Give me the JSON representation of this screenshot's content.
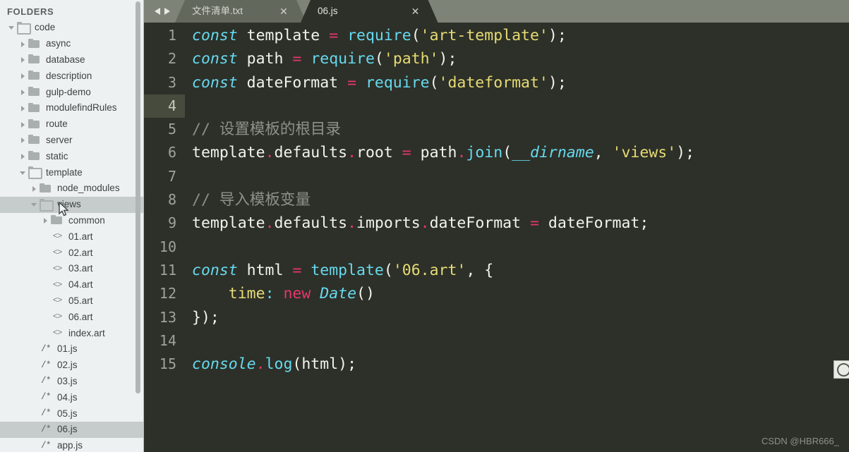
{
  "sidebar": {
    "header": "FOLDERS",
    "scrollbar": {
      "name": "sidebar-scrollbar"
    },
    "tree": [
      {
        "label": "code",
        "depth": 0,
        "kind": "folder",
        "state": "open",
        "selected": false
      },
      {
        "label": "async",
        "depth": 1,
        "kind": "folder",
        "state": "closed",
        "selected": false
      },
      {
        "label": "database",
        "depth": 1,
        "kind": "folder",
        "state": "closed",
        "selected": false
      },
      {
        "label": "description",
        "depth": 1,
        "kind": "folder",
        "state": "closed",
        "selected": false
      },
      {
        "label": "gulp-demo",
        "depth": 1,
        "kind": "folder",
        "state": "closed",
        "selected": false
      },
      {
        "label": "modulefindRules",
        "depth": 1,
        "kind": "folder",
        "state": "closed",
        "selected": false
      },
      {
        "label": "route",
        "depth": 1,
        "kind": "folder",
        "state": "closed",
        "selected": false
      },
      {
        "label": "server",
        "depth": 1,
        "kind": "folder",
        "state": "closed",
        "selected": false
      },
      {
        "label": "static",
        "depth": 1,
        "kind": "folder",
        "state": "closed",
        "selected": false
      },
      {
        "label": "template",
        "depth": 1,
        "kind": "folder",
        "state": "open",
        "selected": false
      },
      {
        "label": "node_modules",
        "depth": 2,
        "kind": "folder",
        "state": "closed",
        "selected": false
      },
      {
        "label": "views",
        "depth": 2,
        "kind": "folder",
        "state": "open",
        "selected": true
      },
      {
        "label": "common",
        "depth": 3,
        "kind": "folder",
        "state": "closed",
        "selected": false
      },
      {
        "label": "01.art",
        "depth": 3,
        "kind": "art",
        "state": "file",
        "selected": false
      },
      {
        "label": "02.art",
        "depth": 3,
        "kind": "art",
        "state": "file",
        "selected": false
      },
      {
        "label": "03.art",
        "depth": 3,
        "kind": "art",
        "state": "file",
        "selected": false
      },
      {
        "label": "04.art",
        "depth": 3,
        "kind": "art",
        "state": "file",
        "selected": false
      },
      {
        "label": "05.art",
        "depth": 3,
        "kind": "art",
        "state": "file",
        "selected": false
      },
      {
        "label": "06.art",
        "depth": 3,
        "kind": "art",
        "state": "file",
        "selected": false
      },
      {
        "label": "index.art",
        "depth": 3,
        "kind": "art",
        "state": "file",
        "selected": false
      },
      {
        "label": "01.js",
        "depth": 2,
        "kind": "js",
        "state": "file",
        "selected": false
      },
      {
        "label": "02.js",
        "depth": 2,
        "kind": "js",
        "state": "file",
        "selected": false
      },
      {
        "label": "03.js",
        "depth": 2,
        "kind": "js",
        "state": "file",
        "selected": false
      },
      {
        "label": "04.js",
        "depth": 2,
        "kind": "js",
        "state": "file",
        "selected": false
      },
      {
        "label": "05.js",
        "depth": 2,
        "kind": "js",
        "state": "file",
        "selected": false
      },
      {
        "label": "06.js",
        "depth": 2,
        "kind": "js",
        "state": "file",
        "selected": true
      },
      {
        "label": "app.js",
        "depth": 2,
        "kind": "js",
        "state": "file",
        "selected": false
      }
    ],
    "icons": {
      "art": "<>",
      "js": "/*"
    }
  },
  "tabbar": {
    "nav_prev": "prev-tab-arrow",
    "nav_next": "next-tab-arrow",
    "close_glyph": "✕",
    "tabs": [
      {
        "label": "文件清单.txt",
        "active": false
      },
      {
        "label": "06.js",
        "active": true
      }
    ]
  },
  "editor": {
    "active_line": 4,
    "lines": [
      {
        "n": "1",
        "tokens": [
          {
            "t": "const ",
            "c": "t-kw"
          },
          {
            "t": "template ",
            "c": "t-plain"
          },
          {
            "t": "=",
            "c": "t-op"
          },
          {
            "t": " ",
            "c": "t-plain"
          },
          {
            "t": "require",
            "c": "t-fn"
          },
          {
            "t": "(",
            "c": "t-punct"
          },
          {
            "t": "'art-template'",
            "c": "t-str"
          },
          {
            "t": ")",
            "c": "t-punct"
          },
          {
            "t": ";",
            "c": "t-punct"
          }
        ]
      },
      {
        "n": "2",
        "tokens": [
          {
            "t": "const ",
            "c": "t-kw"
          },
          {
            "t": "path ",
            "c": "t-plain"
          },
          {
            "t": "=",
            "c": "t-op"
          },
          {
            "t": " ",
            "c": "t-plain"
          },
          {
            "t": "require",
            "c": "t-fn"
          },
          {
            "t": "(",
            "c": "t-punct"
          },
          {
            "t": "'path'",
            "c": "t-str"
          },
          {
            "t": ")",
            "c": "t-punct"
          },
          {
            "t": ";",
            "c": "t-punct"
          }
        ]
      },
      {
        "n": "3",
        "tokens": [
          {
            "t": "const ",
            "c": "t-kw"
          },
          {
            "t": "dateFormat ",
            "c": "t-plain"
          },
          {
            "t": "=",
            "c": "t-op"
          },
          {
            "t": " ",
            "c": "t-plain"
          },
          {
            "t": "require",
            "c": "t-fn"
          },
          {
            "t": "(",
            "c": "t-punct"
          },
          {
            "t": "'dateformat'",
            "c": "t-str"
          },
          {
            "t": ")",
            "c": "t-punct"
          },
          {
            "t": ";",
            "c": "t-punct"
          }
        ]
      },
      {
        "n": "4",
        "tokens": []
      },
      {
        "n": "5",
        "tokens": [
          {
            "t": "// 设置模板的根目录",
            "c": "t-comment"
          }
        ]
      },
      {
        "n": "6",
        "tokens": [
          {
            "t": "template",
            "c": "t-plain"
          },
          {
            "t": ".",
            "c": "t-dot"
          },
          {
            "t": "defaults",
            "c": "t-plain"
          },
          {
            "t": ".",
            "c": "t-dot"
          },
          {
            "t": "root ",
            "c": "t-plain"
          },
          {
            "t": "=",
            "c": "t-op"
          },
          {
            "t": " ",
            "c": "t-plain"
          },
          {
            "t": "path",
            "c": "t-plain"
          },
          {
            "t": ".",
            "c": "t-dot"
          },
          {
            "t": "join",
            "c": "t-fn"
          },
          {
            "t": "(",
            "c": "t-punct"
          },
          {
            "t": "__dirname",
            "c": "t-ital"
          },
          {
            "t": ", ",
            "c": "t-punct"
          },
          {
            "t": "'views'",
            "c": "t-str"
          },
          {
            "t": ")",
            "c": "t-punct"
          },
          {
            "t": ";",
            "c": "t-punct"
          }
        ]
      },
      {
        "n": "7",
        "tokens": []
      },
      {
        "n": "8",
        "tokens": [
          {
            "t": "// 导入模板变量",
            "c": "t-comment"
          }
        ]
      },
      {
        "n": "9",
        "tokens": [
          {
            "t": "template",
            "c": "t-plain"
          },
          {
            "t": ".",
            "c": "t-dot"
          },
          {
            "t": "defaults",
            "c": "t-plain"
          },
          {
            "t": ".",
            "c": "t-dot"
          },
          {
            "t": "imports",
            "c": "t-plain"
          },
          {
            "t": ".",
            "c": "t-dot"
          },
          {
            "t": "dateFormat ",
            "c": "t-plain"
          },
          {
            "t": "=",
            "c": "t-op"
          },
          {
            "t": " ",
            "c": "t-plain"
          },
          {
            "t": "dateFormat",
            "c": "t-plain"
          },
          {
            "t": ";",
            "c": "t-punct"
          }
        ]
      },
      {
        "n": "10",
        "tokens": []
      },
      {
        "n": "11",
        "tokens": [
          {
            "t": "const ",
            "c": "t-kw"
          },
          {
            "t": "html ",
            "c": "t-plain"
          },
          {
            "t": "=",
            "c": "t-op"
          },
          {
            "t": " ",
            "c": "t-plain"
          },
          {
            "t": "template",
            "c": "t-fn"
          },
          {
            "t": "(",
            "c": "t-punct"
          },
          {
            "t": "'06.art'",
            "c": "t-str"
          },
          {
            "t": ", ",
            "c": "t-punct"
          },
          {
            "t": "{",
            "c": "t-punct"
          }
        ]
      },
      {
        "n": "12",
        "tokens": [
          {
            "t": "    ",
            "c": "t-plain"
          },
          {
            "t": "time",
            "c": "t-prop"
          },
          {
            "t": ":",
            "c": "t-colon"
          },
          {
            "t": " ",
            "c": "t-plain"
          },
          {
            "t": "new ",
            "c": "t-new"
          },
          {
            "t": "Date",
            "c": "t-ital"
          },
          {
            "t": "()",
            "c": "t-punct"
          }
        ]
      },
      {
        "n": "13",
        "tokens": [
          {
            "t": "});",
            "c": "t-punct"
          }
        ]
      },
      {
        "n": "14",
        "tokens": []
      },
      {
        "n": "15",
        "tokens": [
          {
            "t": "console",
            "c": "t-ital"
          },
          {
            "t": ".",
            "c": "t-dot"
          },
          {
            "t": "log",
            "c": "t-fn"
          },
          {
            "t": "(",
            "c": "t-punct"
          },
          {
            "t": "html",
            "c": "t-plain"
          },
          {
            "t": ")",
            "c": "t-punct"
          },
          {
            "t": ";",
            "c": "t-punct"
          }
        ]
      }
    ]
  },
  "watermark": "CSDN @HBR666_",
  "colors": {
    "sidebar_bg": "#eef1f1",
    "sidebar_selected": "#c6cbcb",
    "editor_bg": "#2d3028",
    "tabbar_bg": "#7e8377",
    "tab_inactive_bg": "#63685d",
    "keyword": "#66d9ef",
    "string": "#e6db74",
    "operator": "#e6366f",
    "comment": "#8d9189",
    "plain": "#f2f3ed",
    "current_line_gutter": "#474b3e"
  }
}
